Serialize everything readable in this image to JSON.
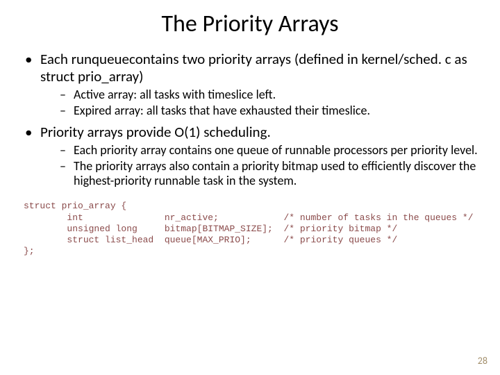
{
  "title": "The Priority Arrays",
  "bullets": {
    "b1": "Each runqueuecontains two priority arrays (defined in kernel/sched. c as struct prio_array)",
    "b1a": "Active array: all tasks with timeslice left.",
    "b1b": "Expired array: all tasks that have exhausted their timeslice.",
    "b2": "Priority arrays provide O(1) scheduling.",
    "b2a": "Each priority array contains one queue of runnable processors per priority level.",
    "b2b": "The priority arrays also contain a priority bitmap used to efficiently discover the highest-priority runnable task in the system."
  },
  "code": "struct prio_array {\n        int               nr_active;            /* number of tasks in the queues */\n        unsigned long     bitmap[BITMAP_SIZE];  /* priority bitmap */\n        struct list_head  queue[MAX_PRIO];      /* priority queues */\n};",
  "page_number": "28"
}
